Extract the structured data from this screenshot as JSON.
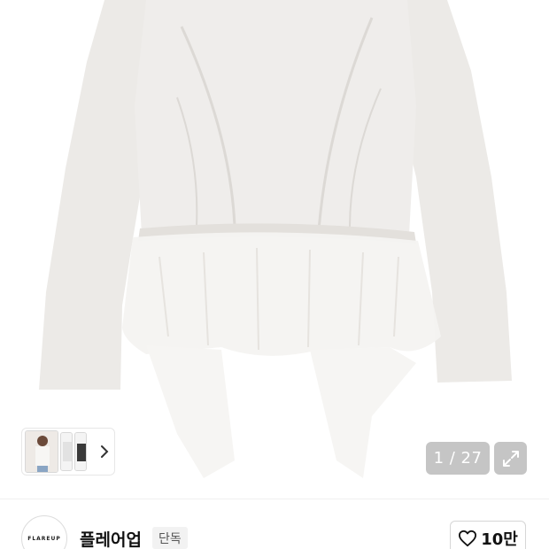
{
  "gallery": {
    "counter": "1 / 27",
    "expand_icon": "expand-arrows-icon",
    "thumbnail_arrow_icon": "chevron-right-icon"
  },
  "seller": {
    "logo_text": "FLAREUP",
    "name": "플레어업",
    "badge": "단독"
  },
  "like": {
    "icon": "heart-outline-icon",
    "count": "10만"
  },
  "colors": {
    "background": "#ffffff",
    "garment": "#efedeb",
    "overlay": "#969696"
  }
}
